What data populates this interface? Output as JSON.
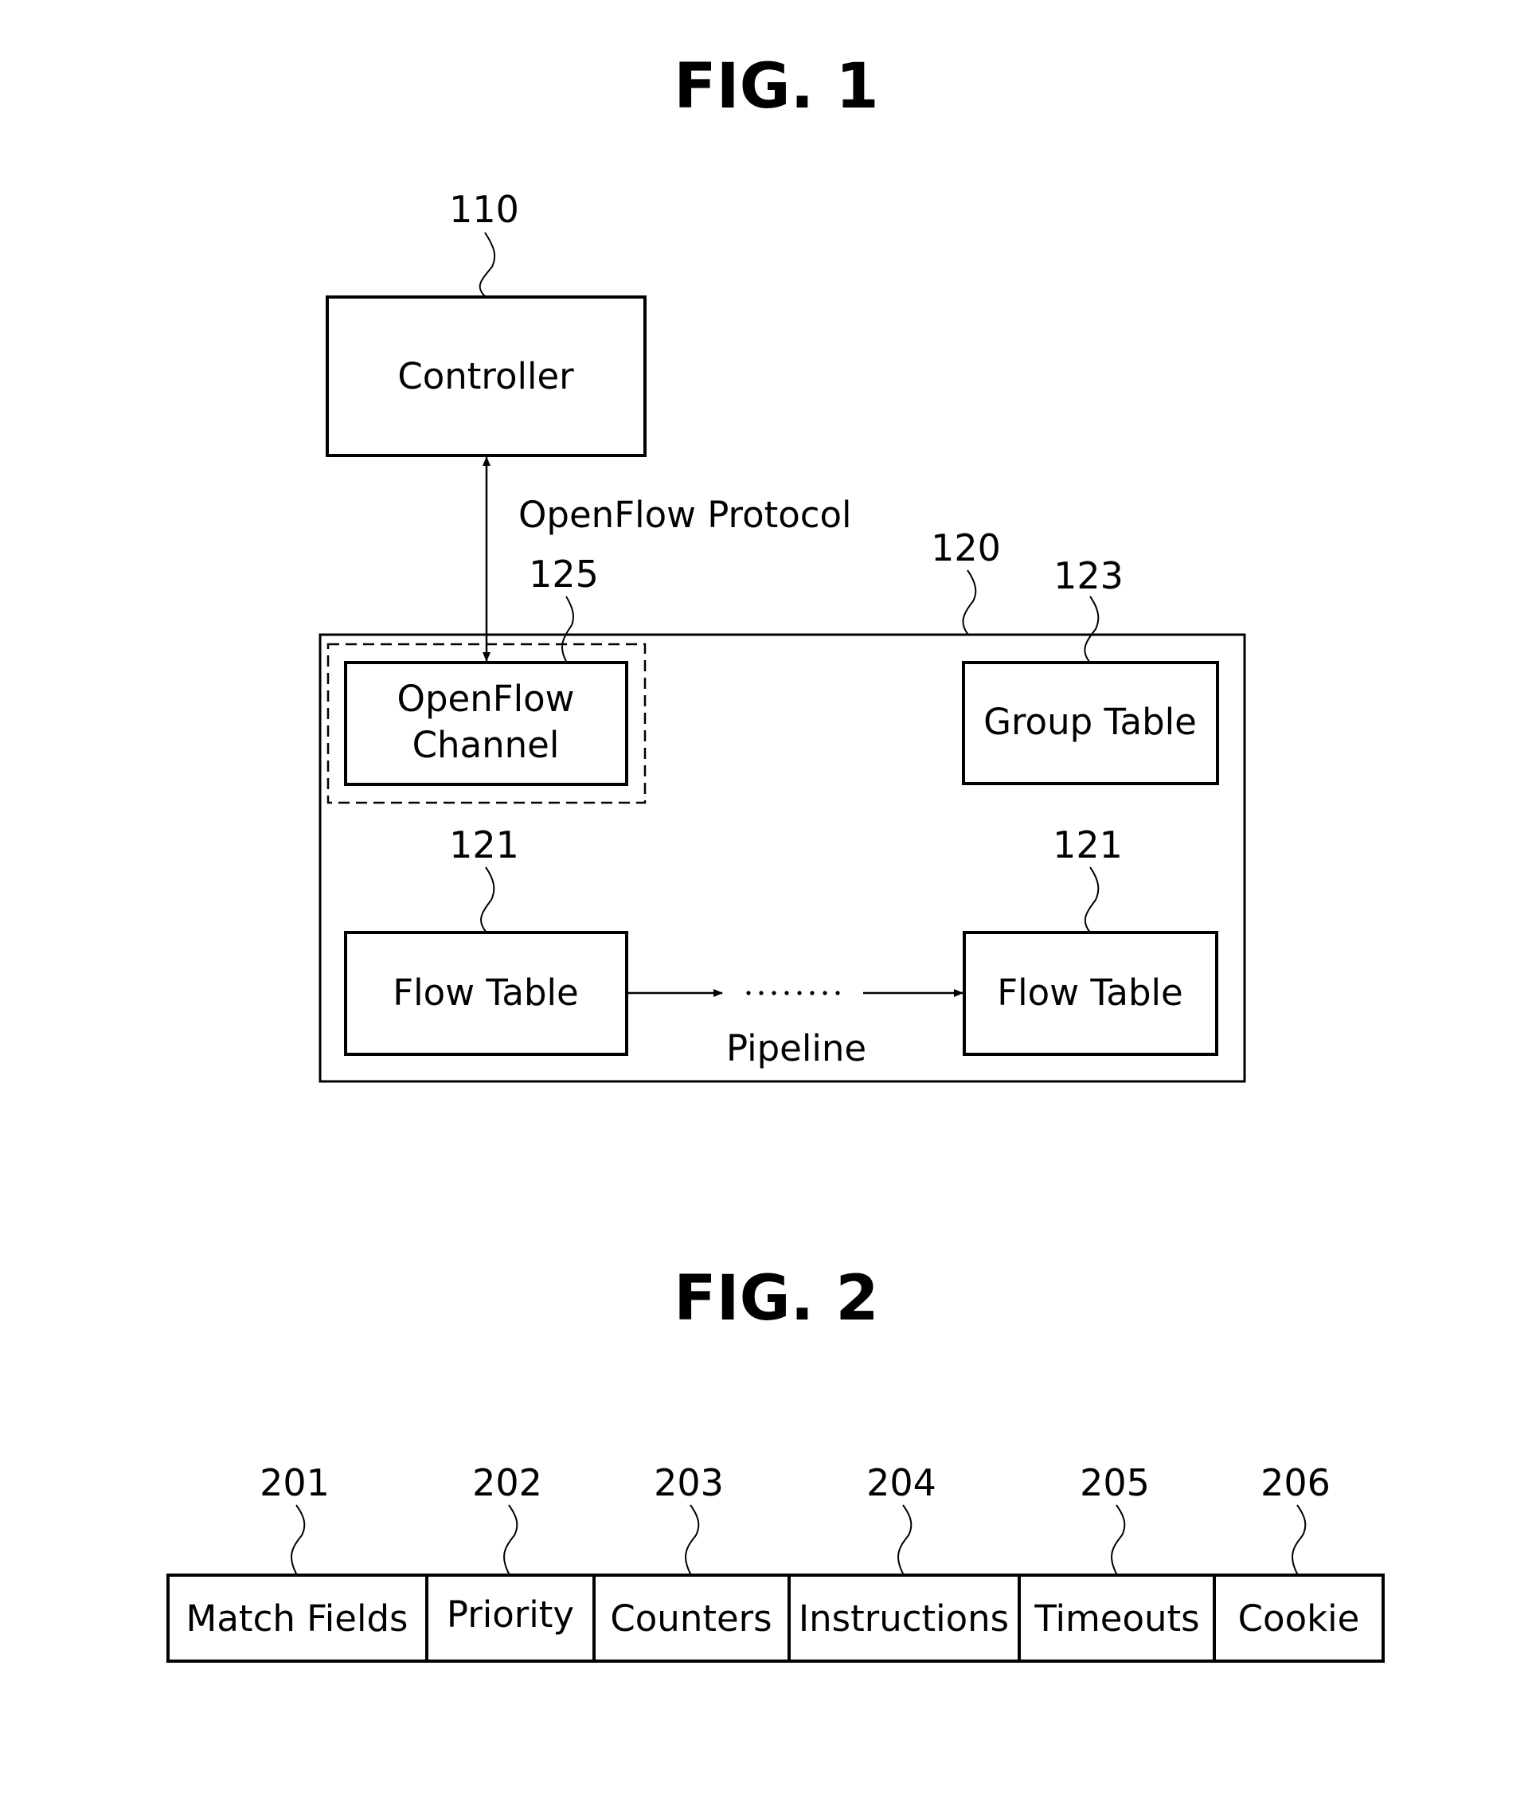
{
  "colors": {
    "ink": "#000000",
    "background": "#ffffff"
  },
  "fig1": {
    "title": "FIG. 1",
    "controller": {
      "ref": "110",
      "label": "Controller"
    },
    "protocol_label": "OpenFlow Protocol",
    "switch": {
      "ref": "120"
    },
    "channel": {
      "ref": "125",
      "label_line1": "OpenFlow",
      "label_line2": "Channel"
    },
    "group_table": {
      "ref": "123",
      "label": "Group Table"
    },
    "flow_tables": [
      {
        "ref": "121",
        "label": "Flow Table"
      },
      {
        "ref": "121",
        "label": "Flow Table"
      }
    ],
    "pipeline_label": "Pipeline",
    "pipeline_ellipsis_dots": 8
  },
  "fig2": {
    "title": "FIG. 2",
    "fields": [
      {
        "ref": "201",
        "label": "Match Fields"
      },
      {
        "ref": "202",
        "label": "Priority"
      },
      {
        "ref": "203",
        "label": "Counters"
      },
      {
        "ref": "204",
        "label": "Instructions"
      },
      {
        "ref": "205",
        "label": "Timeouts"
      },
      {
        "ref": "206",
        "label": "Cookie"
      }
    ]
  }
}
